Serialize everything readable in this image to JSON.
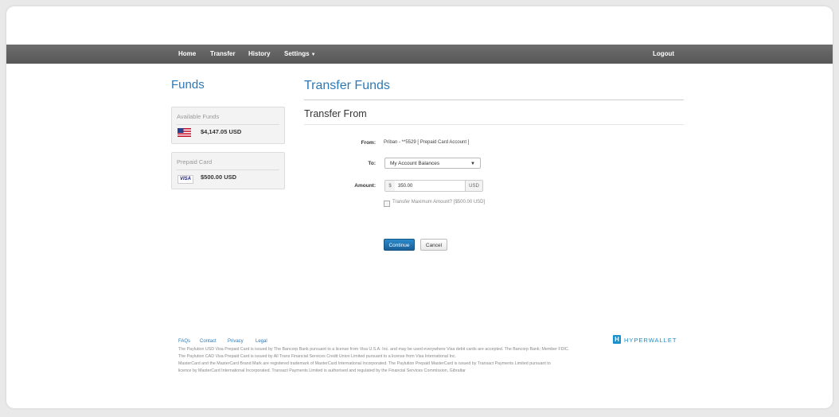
{
  "nav": {
    "home": "Home",
    "transfer": "Transfer",
    "history": "History",
    "settings": "Settings",
    "logout": "Logout"
  },
  "sidebar": {
    "title": "Funds",
    "available": {
      "label": "Available Funds",
      "amount": "$4,147.05 USD"
    },
    "prepaid": {
      "label": "Prepaid Card",
      "amount": "$500.00 USD",
      "card_brand": "VISA"
    }
  },
  "main": {
    "title": "Transfer Funds",
    "subtitle": "Transfer From",
    "form": {
      "from_label": "From:",
      "from_value": "Priban - **5529 [ Prepaid Card Account ]",
      "to_label": "To:",
      "to_value": "My Account Balances",
      "amount_label": "Amount:",
      "currency_symbol": "$",
      "amount_value": "350.00",
      "currency_code": "USD",
      "max_label": "Transfer Maximum Amount? [$500.00 USD]",
      "max_checked": false
    },
    "buttons": {
      "continue": "Continue",
      "cancel": "Cancel"
    }
  },
  "footer": {
    "links": [
      "FAQs",
      "Contact",
      "Privacy",
      "Legal"
    ],
    "logo_text": "HYPERWALLET",
    "logo_mark": "H",
    "lines": [
      "The Paylution USD Visa Prepaid Card is issued by The Bancorp Bank pursuant to a license from Visa U.S.A. Inc. and may be used everywhere Visa debit cards are accepted. The Bancorp Bank; Member FDIC.",
      "The Paylution CAD Visa Prepaid Card is issued by All Trans Financial Services Credit Union Limited pursuant to a license from Visa International Inc.",
      "MasterCard and the MasterCard Brand Mark are registered trademark of MasterCard International Incorporated. The Paylution Prepaid MasterCard is issued by Transact Payments Limited pursuant to",
      "licence by MasterCard International Incorporated. Transact Payments Limited is authorised and regulated by the Financial Services Commission, Gibraltar"
    ]
  },
  "colors": {
    "accent": "#2e79b5",
    "navbar": "#5f5f5f",
    "logo": "#1a8fc9"
  }
}
